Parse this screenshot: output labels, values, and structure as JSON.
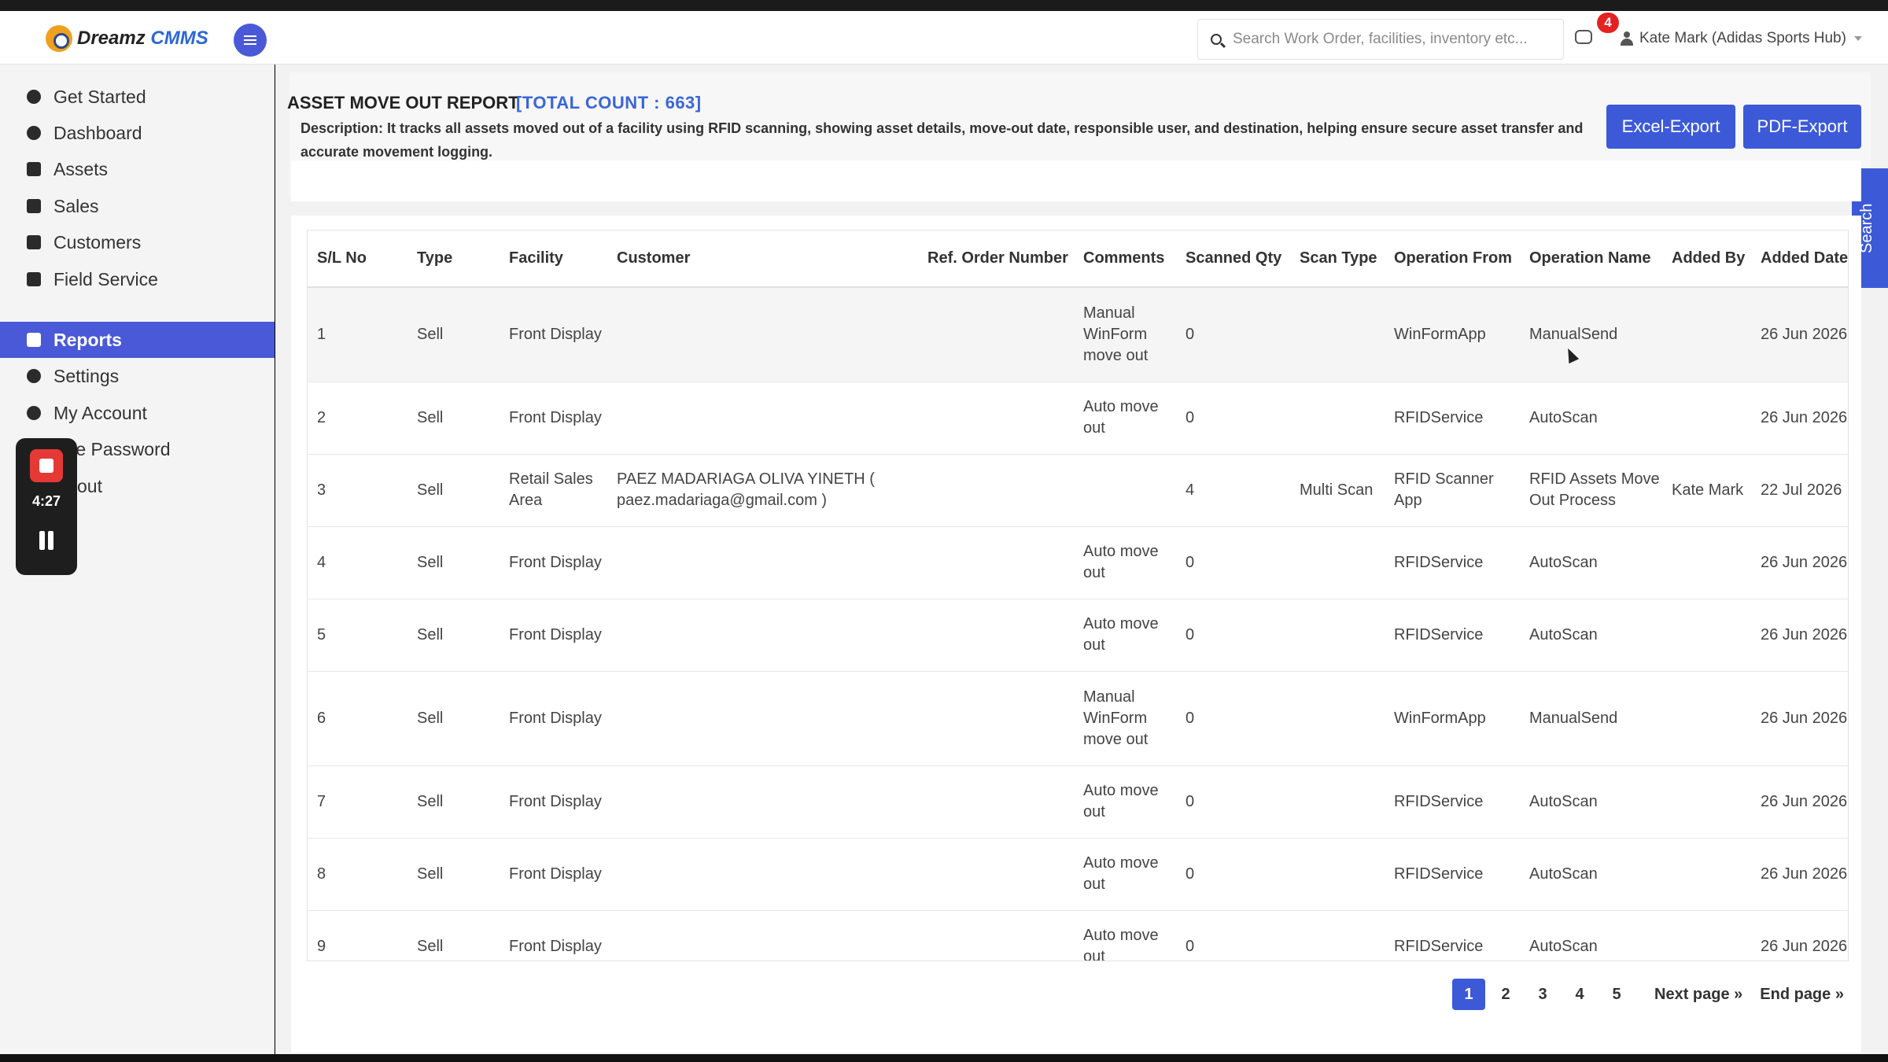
{
  "app": {
    "logo_main": "Dreamz",
    "logo_accent": "CMMS"
  },
  "header": {
    "search_placeholder": "Search Work Order, facilities, inventory etc...",
    "notification_count": "4",
    "user_label": "Kate Mark (Adidas Sports Hub)"
  },
  "sidebar": {
    "items": [
      {
        "label": "Get Started",
        "icon": "cogs-icon"
      },
      {
        "label": "Dashboard",
        "icon": "dashboard-icon"
      },
      {
        "label": "Assets",
        "icon": "archive-icon"
      },
      {
        "label": "Sales",
        "icon": "archive-icon"
      },
      {
        "label": "Customers",
        "icon": "file-icon"
      },
      {
        "label": "Field Service",
        "icon": "archive-icon"
      },
      {
        "label": "Reports",
        "icon": "file-icon",
        "active": true
      },
      {
        "label": "Settings",
        "icon": "gear-icon"
      },
      {
        "label": "My Account",
        "icon": "gear-icon"
      },
      {
        "label": "ange Password",
        "icon": "key-icon"
      },
      {
        "label": "out",
        "icon": "logout-icon"
      }
    ]
  },
  "recorder": {
    "time": "4:27"
  },
  "report": {
    "title": "ASSET MOVE OUT REPORT",
    "count_label": "[TOTAL COUNT : 663]",
    "description": "Description: It tracks all assets moved out of a facility using RFID scanning, showing asset details, move-out date, responsible user, and destination, helping ensure secure asset transfer and accurate movement logging.",
    "excel_button": "Excel-Export",
    "pdf_button": "PDF-Export",
    "search_tab": "Search"
  },
  "table": {
    "columns": [
      "S/L No",
      "Type",
      "Facility",
      "Customer",
      "Ref. Order Number",
      "Comments",
      "Scanned Qty",
      "Scan Type",
      "Operation From",
      "Operation Name",
      "Added By",
      "Added Date"
    ],
    "rows": [
      [
        "1",
        "Sell",
        "Front Display",
        "",
        "",
        "Manual WinForm move out",
        "0",
        "",
        "WinFormApp",
        "ManualSend",
        "",
        "26 Jun 2026"
      ],
      [
        "2",
        "Sell",
        "Front Display",
        "",
        "",
        "Auto move out",
        "0",
        "",
        "RFIDService",
        "AutoScan",
        "",
        "26 Jun 2026"
      ],
      [
        "3",
        "Sell",
        "Retail Sales Area",
        "PAEZ MADARIAGA OLIVA YINETH ( paez.madariaga@gmail.com )",
        "",
        "",
        "4",
        "Multi Scan",
        "RFID Scanner App",
        "RFID Assets Move Out Process",
        "Kate Mark",
        "22 Jul 2026"
      ],
      [
        "4",
        "Sell",
        "Front Display",
        "",
        "",
        "Auto move out",
        "0",
        "",
        "RFIDService",
        "AutoScan",
        "",
        "26 Jun 2026"
      ],
      [
        "5",
        "Sell",
        "Front Display",
        "",
        "",
        "Auto move out",
        "0",
        "",
        "RFIDService",
        "AutoScan",
        "",
        "26 Jun 2026"
      ],
      [
        "6",
        "Sell",
        "Front Display",
        "",
        "",
        "Manual WinForm move out",
        "0",
        "",
        "WinFormApp",
        "ManualSend",
        "",
        "26 Jun 2026"
      ],
      [
        "7",
        "Sell",
        "Front Display",
        "",
        "",
        "Auto move out",
        "0",
        "",
        "RFIDService",
        "AutoScan",
        "",
        "26 Jun 2026"
      ],
      [
        "8",
        "Sell",
        "Front Display",
        "",
        "",
        "Auto move out",
        "0",
        "",
        "RFIDService",
        "AutoScan",
        "",
        "26 Jun 2026"
      ],
      [
        "9",
        "Sell",
        "Front Display",
        "",
        "",
        "Auto move out",
        "0",
        "",
        "RFIDService",
        "AutoScan",
        "",
        "26 Jun 2026"
      ]
    ]
  },
  "pagination": {
    "pages": [
      "1",
      "2",
      "3",
      "4",
      "5"
    ],
    "active": "1",
    "next_label": "Next page »",
    "end_label": "End page »"
  },
  "colors": {
    "accent": "#3c5ad8",
    "sidebar_active": "#4a59d8",
    "count_text": "#3a66d6",
    "badge": "#e52222",
    "recorder_stop": "#e53935"
  }
}
